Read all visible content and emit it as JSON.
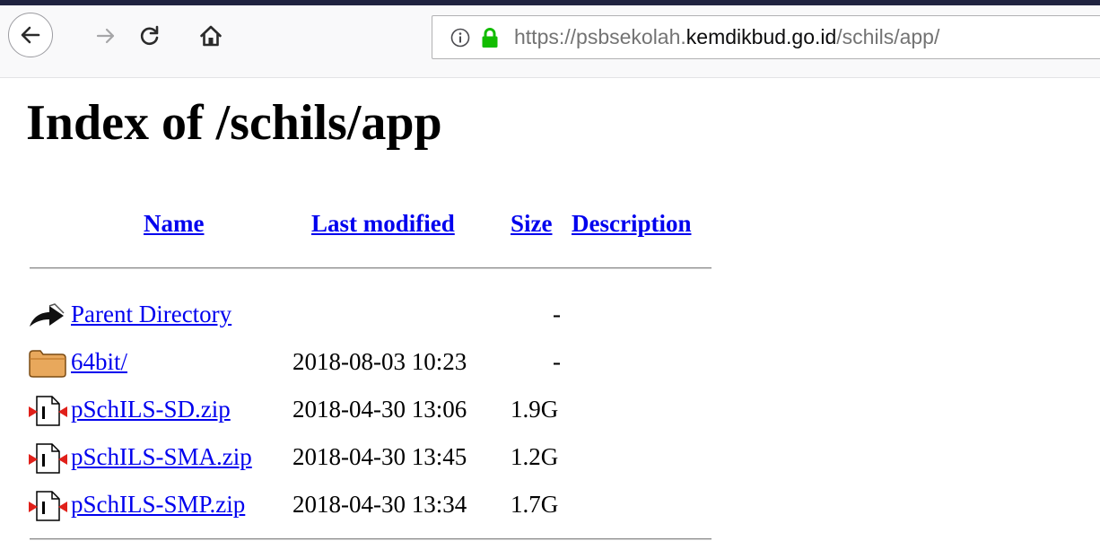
{
  "browser": {
    "url_prefix": "https://psbsekolah.",
    "url_host": "kemdikbud.go.id",
    "url_path": "/schils/app/",
    "icons": {
      "back": "back-arrow-icon",
      "forward": "forward-arrow-icon",
      "reload": "reload-icon",
      "home": "home-icon",
      "info": "info-icon",
      "lock": "lock-icon"
    },
    "lock_color": "#12bc00"
  },
  "page": {
    "title": "Index of /schils/app"
  },
  "table": {
    "headers": {
      "name": "Name",
      "last_modified": "Last modified",
      "size": "Size",
      "description": "Description"
    },
    "rows": [
      {
        "icon": "parent-directory-icon",
        "name": "Parent Directory",
        "modified": "",
        "size": "-"
      },
      {
        "icon": "folder-icon",
        "name": "64bit/",
        "modified": "2018-08-03 10:23",
        "size": "-"
      },
      {
        "icon": "zip-file-icon",
        "name": "pSchILS-SD.zip",
        "modified": "2018-04-30 13:06",
        "size": "1.9G"
      },
      {
        "icon": "zip-file-icon",
        "name": "pSchILS-SMA.zip",
        "modified": "2018-04-30 13:45",
        "size": "1.2G"
      },
      {
        "icon": "zip-file-icon",
        "name": "pSchILS-SMP.zip",
        "modified": "2018-04-30 13:34",
        "size": "1.7G"
      }
    ]
  },
  "colors": {
    "link": "#0000ee",
    "chrome": "#f9f9fa",
    "tabstrip": "#202340"
  }
}
